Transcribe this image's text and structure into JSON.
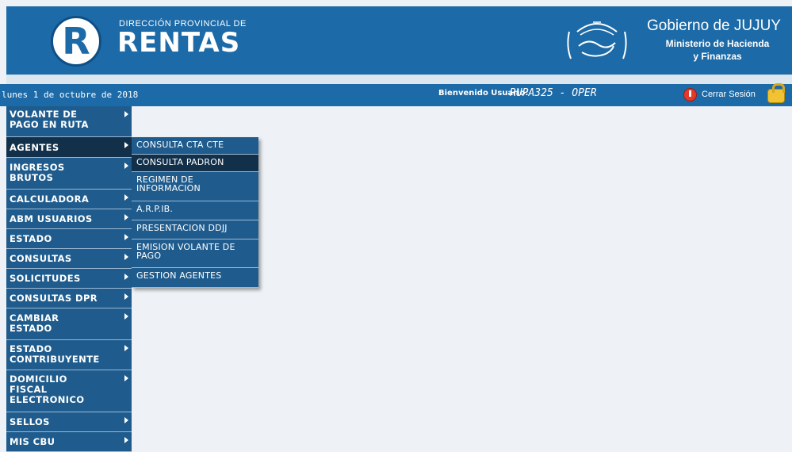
{
  "header": {
    "logo_letter": "R",
    "brand_sub": "DIRECCIÓN PROVINCIAL DE",
    "brand_main": "RENTAS",
    "gov_title": "Gobierno de JUJUY",
    "gov_sub1": "Ministerio de Hacienda",
    "gov_sub2": "y Finanzas"
  },
  "statusbar": {
    "date": "lunes 1 de octubre de 2018",
    "welcome_label": "Bienvenido Usuario:",
    "welcome_user": "RUPA325 - OPER",
    "logout_label": "Cerrar Sesión"
  },
  "sidebar": {
    "items": [
      {
        "label": "VOLANTE DE PAGO EN RUTA"
      },
      {
        "label": "AGENTES"
      },
      {
        "label": "INGRESOS BRUTOS"
      },
      {
        "label": "CALCULADORA"
      },
      {
        "label": "ABM USUARIOS"
      },
      {
        "label": "ESTADO"
      },
      {
        "label": "CONSULTAS"
      },
      {
        "label": "SOLICITUDES"
      },
      {
        "label": "CONSULTAS DPR"
      },
      {
        "label": "CAMBIAR ESTADO"
      },
      {
        "label": "ESTADO CONTRIBUYENTE"
      },
      {
        "label": "DOMICILIO FISCAL ELECTRONICO"
      },
      {
        "label": "SELLOS"
      },
      {
        "label": "MIS CBU"
      }
    ]
  },
  "submenu": {
    "items": [
      {
        "label": "CONSULTA CTA CTE"
      },
      {
        "label": "CONSULTA PADRON"
      },
      {
        "label": "REGIMEN DE INFORMACION"
      },
      {
        "label": "A.R.P.IB."
      },
      {
        "label": "PRESENTACION DDJJ"
      },
      {
        "label": "EMISION VOLANTE DE PAGO"
      },
      {
        "label": "GESTION AGENTES"
      }
    ]
  },
  "colors": {
    "header_bg": "#1c6aa7",
    "menu_bg": "#1f5c8d",
    "menu_active_bg": "#12304a",
    "page_bg": "#eef2f6"
  }
}
